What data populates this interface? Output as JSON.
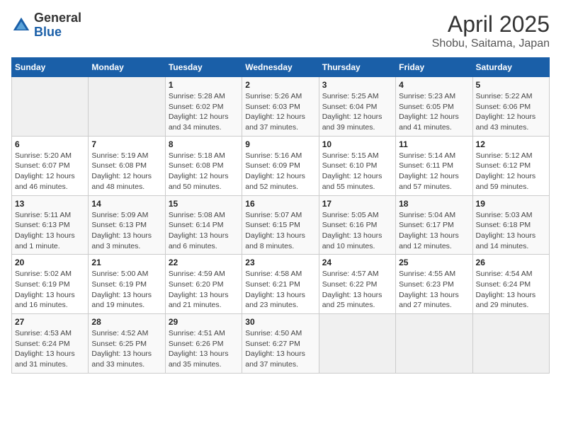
{
  "header": {
    "logo_general": "General",
    "logo_blue": "Blue",
    "title": "April 2025",
    "subtitle": "Shobu, Saitama, Japan"
  },
  "calendar": {
    "days_of_week": [
      "Sunday",
      "Monday",
      "Tuesday",
      "Wednesday",
      "Thursday",
      "Friday",
      "Saturday"
    ],
    "weeks": [
      [
        {
          "day": "",
          "info": ""
        },
        {
          "day": "",
          "info": ""
        },
        {
          "day": "1",
          "info": "Sunrise: 5:28 AM\nSunset: 6:02 PM\nDaylight: 12 hours and 34 minutes."
        },
        {
          "day": "2",
          "info": "Sunrise: 5:26 AM\nSunset: 6:03 PM\nDaylight: 12 hours and 37 minutes."
        },
        {
          "day": "3",
          "info": "Sunrise: 5:25 AM\nSunset: 6:04 PM\nDaylight: 12 hours and 39 minutes."
        },
        {
          "day": "4",
          "info": "Sunrise: 5:23 AM\nSunset: 6:05 PM\nDaylight: 12 hours and 41 minutes."
        },
        {
          "day": "5",
          "info": "Sunrise: 5:22 AM\nSunset: 6:06 PM\nDaylight: 12 hours and 43 minutes."
        }
      ],
      [
        {
          "day": "6",
          "info": "Sunrise: 5:20 AM\nSunset: 6:07 PM\nDaylight: 12 hours and 46 minutes."
        },
        {
          "day": "7",
          "info": "Sunrise: 5:19 AM\nSunset: 6:08 PM\nDaylight: 12 hours and 48 minutes."
        },
        {
          "day": "8",
          "info": "Sunrise: 5:18 AM\nSunset: 6:08 PM\nDaylight: 12 hours and 50 minutes."
        },
        {
          "day": "9",
          "info": "Sunrise: 5:16 AM\nSunset: 6:09 PM\nDaylight: 12 hours and 52 minutes."
        },
        {
          "day": "10",
          "info": "Sunrise: 5:15 AM\nSunset: 6:10 PM\nDaylight: 12 hours and 55 minutes."
        },
        {
          "day": "11",
          "info": "Sunrise: 5:14 AM\nSunset: 6:11 PM\nDaylight: 12 hours and 57 minutes."
        },
        {
          "day": "12",
          "info": "Sunrise: 5:12 AM\nSunset: 6:12 PM\nDaylight: 12 hours and 59 minutes."
        }
      ],
      [
        {
          "day": "13",
          "info": "Sunrise: 5:11 AM\nSunset: 6:13 PM\nDaylight: 13 hours and 1 minute."
        },
        {
          "day": "14",
          "info": "Sunrise: 5:09 AM\nSunset: 6:13 PM\nDaylight: 13 hours and 3 minutes."
        },
        {
          "day": "15",
          "info": "Sunrise: 5:08 AM\nSunset: 6:14 PM\nDaylight: 13 hours and 6 minutes."
        },
        {
          "day": "16",
          "info": "Sunrise: 5:07 AM\nSunset: 6:15 PM\nDaylight: 13 hours and 8 minutes."
        },
        {
          "day": "17",
          "info": "Sunrise: 5:05 AM\nSunset: 6:16 PM\nDaylight: 13 hours and 10 minutes."
        },
        {
          "day": "18",
          "info": "Sunrise: 5:04 AM\nSunset: 6:17 PM\nDaylight: 13 hours and 12 minutes."
        },
        {
          "day": "19",
          "info": "Sunrise: 5:03 AM\nSunset: 6:18 PM\nDaylight: 13 hours and 14 minutes."
        }
      ],
      [
        {
          "day": "20",
          "info": "Sunrise: 5:02 AM\nSunset: 6:19 PM\nDaylight: 13 hours and 16 minutes."
        },
        {
          "day": "21",
          "info": "Sunrise: 5:00 AM\nSunset: 6:19 PM\nDaylight: 13 hours and 19 minutes."
        },
        {
          "day": "22",
          "info": "Sunrise: 4:59 AM\nSunset: 6:20 PM\nDaylight: 13 hours and 21 minutes."
        },
        {
          "day": "23",
          "info": "Sunrise: 4:58 AM\nSunset: 6:21 PM\nDaylight: 13 hours and 23 minutes."
        },
        {
          "day": "24",
          "info": "Sunrise: 4:57 AM\nSunset: 6:22 PM\nDaylight: 13 hours and 25 minutes."
        },
        {
          "day": "25",
          "info": "Sunrise: 4:55 AM\nSunset: 6:23 PM\nDaylight: 13 hours and 27 minutes."
        },
        {
          "day": "26",
          "info": "Sunrise: 4:54 AM\nSunset: 6:24 PM\nDaylight: 13 hours and 29 minutes."
        }
      ],
      [
        {
          "day": "27",
          "info": "Sunrise: 4:53 AM\nSunset: 6:24 PM\nDaylight: 13 hours and 31 minutes."
        },
        {
          "day": "28",
          "info": "Sunrise: 4:52 AM\nSunset: 6:25 PM\nDaylight: 13 hours and 33 minutes."
        },
        {
          "day": "29",
          "info": "Sunrise: 4:51 AM\nSunset: 6:26 PM\nDaylight: 13 hours and 35 minutes."
        },
        {
          "day": "30",
          "info": "Sunrise: 4:50 AM\nSunset: 6:27 PM\nDaylight: 13 hours and 37 minutes."
        },
        {
          "day": "",
          "info": ""
        },
        {
          "day": "",
          "info": ""
        },
        {
          "day": "",
          "info": ""
        }
      ]
    ]
  }
}
